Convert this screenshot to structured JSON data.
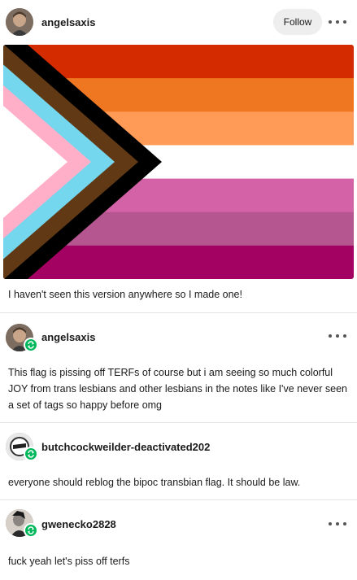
{
  "post": {
    "author": "angelsaxis",
    "follow_label": "Follow",
    "caption": "I haven't seen this version anywhere so I made one!"
  },
  "flag": {
    "stripes": [
      "#d42c00",
      "#f07722",
      "#ff9b56",
      "#ffffff",
      "#d462a6",
      "#b55690",
      "#a30262"
    ],
    "chevrons": [
      "#000000",
      "#613915",
      "#74d7ee",
      "#ffafc8",
      "#ffffff"
    ]
  },
  "reblogs": [
    {
      "username": "angelsaxis",
      "text": "This flag is pissing off TERFs of course but i am seeing so much colorful JOY from trans lesbians and other lesbians in the notes like I've never seen a set of tags so happy before omg"
    },
    {
      "username": "butchcockweilder-deactivated202",
      "text": "everyone should reblog the bipoc transbian flag. It should be law."
    },
    {
      "username": "gwenecko2828",
      "text": "fuck yeah let's piss off terfs"
    }
  ],
  "colors": {
    "reblog_badge": "#00b85c",
    "follow_bg": "#eeeeee"
  }
}
